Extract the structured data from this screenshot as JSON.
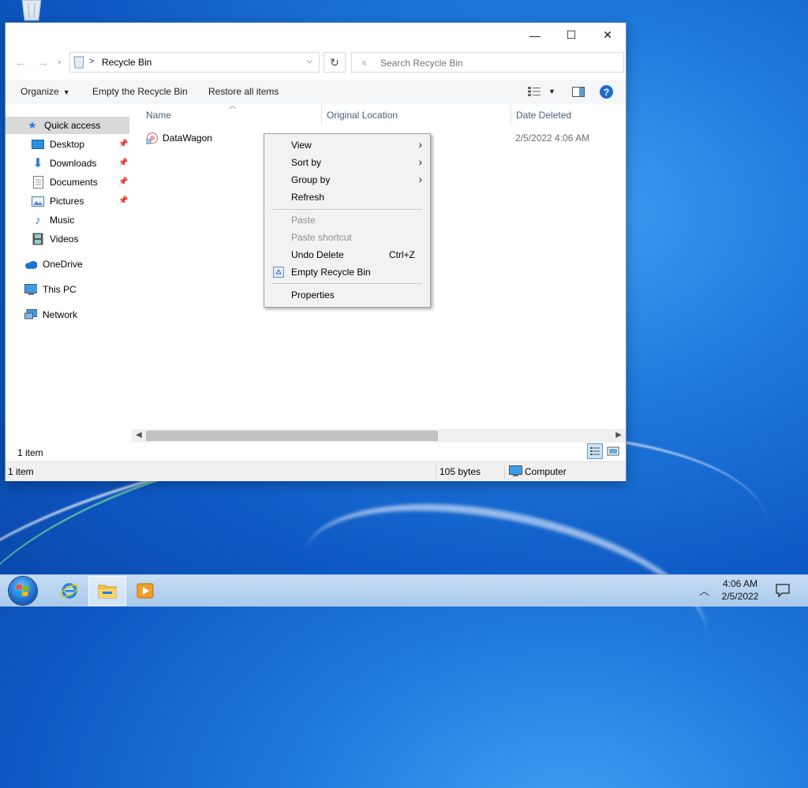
{
  "window": {
    "title_controls": {
      "minimize": "—",
      "maximize": "☐",
      "close": "✕"
    },
    "address": {
      "location": "Recycle Bin",
      "separator": ">"
    },
    "search": {
      "placeholder": "Search Recycle Bin"
    },
    "toolbar": {
      "organize": "Organize",
      "empty": "Empty the Recycle Bin",
      "restore": "Restore all items"
    },
    "nav": {
      "quick_access": "Quick access",
      "items": [
        "Desktop",
        "Downloads",
        "Documents",
        "Pictures",
        "Music",
        "Videos"
      ],
      "onedrive": "OneDrive",
      "this_pc": "This PC",
      "network": "Network"
    },
    "columns": [
      "Name",
      "Original Location",
      "Date Deleted"
    ],
    "files": [
      {
        "name": "DataWagon",
        "date_deleted": "2/5/2022 4:06 AM"
      }
    ],
    "status": {
      "item_count": "1 item",
      "bar_items": "1 item",
      "size": "105 bytes",
      "location": "Computer"
    }
  },
  "context_menu": {
    "view": "View",
    "sort_by": "Sort by",
    "group_by": "Group by",
    "refresh": "Refresh",
    "paste": "Paste",
    "paste_shortcut": "Paste shortcut",
    "undo_delete": "Undo Delete",
    "undo_shortcut": "Ctrl+Z",
    "empty_bin": "Empty Recycle Bin",
    "properties": "Properties"
  },
  "taskbar": {
    "time": "4:06 AM",
    "date": "2/5/2022"
  },
  "colors": {
    "accent": "#0078d7",
    "selection": "#d9d9d9",
    "help": "#1a6dc9"
  }
}
